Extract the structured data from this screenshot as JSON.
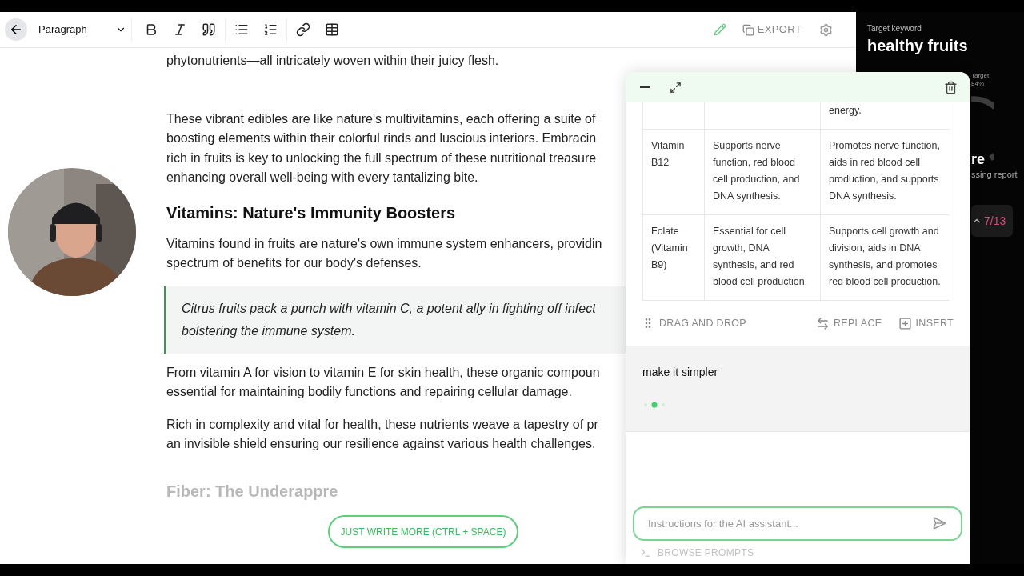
{
  "toolbar": {
    "block_style": "Paragraph",
    "export_label": "EXPORT"
  },
  "document": {
    "blocks": [
      {
        "kind": "paragraph",
        "lines": [
          "phytonutrients—all intricately woven within their juicy flesh."
        ]
      },
      {
        "kind": "paragraph",
        "lines": [
          "These vibrant edibles are like nature's multivitamins, each offering a suite of",
          "boosting elements within their colorful rinds and luscious interiors. Embracin",
          "rich in fruits is key to unlocking the full spectrum of these nutritional treasure",
          "enhancing overall well-being with every tantalizing bite."
        ]
      },
      {
        "kind": "heading",
        "lines": [
          "Vitamins: Nature's Immunity Boosters"
        ]
      },
      {
        "kind": "paragraph",
        "lines": [
          "Vitamins found in fruits are nature's own immune system enhancers, providin",
          "spectrum of benefits for our body's defenses."
        ]
      },
      {
        "kind": "quote",
        "lines": [
          "Citrus fruits pack a punch with vitamin C, a potent ally in fighting off infect",
          "bolstering the immune system."
        ]
      },
      {
        "kind": "paragraph",
        "lines": [
          "From vitamin A for vision to vitamin E for skin health, these organic compoun",
          "essential for maintaining bodily functions and repairing cellular damage."
        ]
      },
      {
        "kind": "paragraph",
        "lines": [
          "Rich in complexity and vital for health, these nutrients weave a tapestry of pr",
          "an invisible shield ensuring our resilience against various health challenges."
        ]
      },
      {
        "kind": "faded_heading",
        "lines": [
          "Fiber: The Underappre"
        ]
      }
    ]
  },
  "write_more_button": "JUST WRITE MORE (CTRL + SPACE)",
  "ai_panel": {
    "table": {
      "rows": [
        [
          "",
          "",
          "energy."
        ],
        [
          "Vitamin B12",
          "Supports nerve function, red blood cell production, and DNA synthesis.",
          "Promotes nerve function, aids in red blood cell production, and supports DNA synthesis."
        ],
        [
          "Folate (Vitamin B9)",
          "Essential for cell growth, DNA synthesis, and red blood cell production.",
          "Supports cell growth and division, aids in DNA synthesis, and promotes red blood cell production."
        ]
      ]
    },
    "drag_label": "DRAG AND DROP",
    "replace_label": "REPLACE",
    "insert_label": "INSERT",
    "prompt": "make it simpler",
    "input_placeholder": "Instructions for the AI assistant...",
    "browse_label": "BROWSE PROMPTS"
  },
  "keyword_panel": {
    "label": "Target keyword",
    "keyword": "healthy fruits",
    "target_label": "Target",
    "target_value": "84%",
    "score_fragment": "re",
    "report_fragment": "ssing report",
    "progress": "7/13"
  }
}
